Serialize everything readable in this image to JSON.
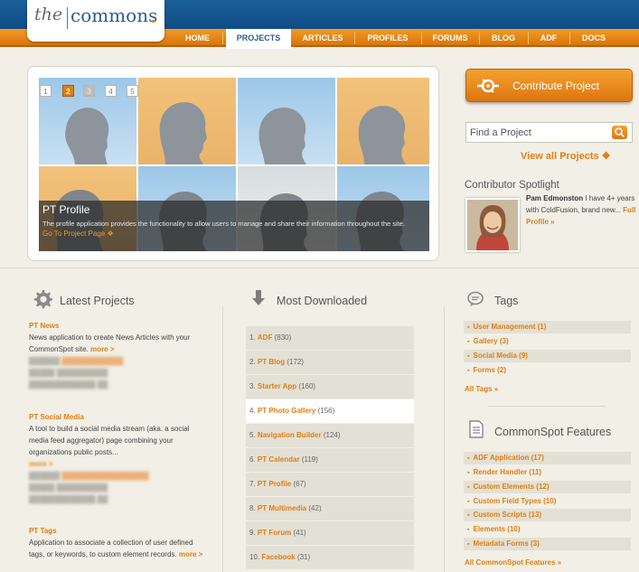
{
  "logo": {
    "the": "the",
    "commons": "commons",
    "dot": "."
  },
  "nav": {
    "items": [
      {
        "label": "HOME"
      },
      {
        "label": "PROJECTS"
      },
      {
        "label": "ARTICLES"
      },
      {
        "label": "PROFILES"
      },
      {
        "label": "FORUMS"
      },
      {
        "label": "BLOG"
      },
      {
        "label": "ADF"
      },
      {
        "label": "DOCS"
      }
    ],
    "active": "PROJECTS"
  },
  "slideshow": {
    "pages": [
      "1",
      "2",
      "3",
      "4",
      "5"
    ],
    "current_page": "2",
    "caption_title": "PT Profile",
    "caption_text": "The profile application provides the functionality to allow users to manage and share their information throughout the site.",
    "caption_link": "Go To Project Page ❖"
  },
  "contribute": {
    "label": "Contribute Project",
    "icon": "contribute-icon"
  },
  "find_project": {
    "placeholder": "Find a Project",
    "icon": "search-icon"
  },
  "view_all": "View all Projects ❖",
  "spotlight": {
    "title": "Contributor Spotlight",
    "name": "Pam Edmonston",
    "text": " I have 4+ years with ColdFusion, brand new... ",
    "link": "Full Profile »"
  },
  "latest": {
    "title": "Latest Projects",
    "icon": "gear-icon",
    "items": [
      {
        "name": "PT News",
        "desc": "News application to create News Articles with your CommonSpot site.",
        "more": "more >"
      },
      {
        "name": "PT Social Media",
        "desc": "A tool to build a social media stream (aka. a social media feed aggregator) page combining your organizations public posts...",
        "more": "more >"
      },
      {
        "name": "PT Tags",
        "desc": "Application to associate a collection of user defined tags, or keywords, to custom element records.",
        "more": "more >"
      }
    ]
  },
  "downloaded": {
    "title": "Most Downloaded",
    "icon": "download-arrow-icon",
    "items": [
      {
        "rank": "1.",
        "name": "ADF",
        "count": "(830)"
      },
      {
        "rank": "2.",
        "name": "PT Blog",
        "count": "(172)"
      },
      {
        "rank": "3.",
        "name": "Starter App",
        "count": "(160)"
      },
      {
        "rank": "4.",
        "name": "PT Photo Gallery",
        "count": "(156)"
      },
      {
        "rank": "5.",
        "name": "Navigation Builder",
        "count": "(124)"
      },
      {
        "rank": "6.",
        "name": "PT Calendar",
        "count": "(119)"
      },
      {
        "rank": "7.",
        "name": "PT Profile",
        "count": "(67)"
      },
      {
        "rank": "8.",
        "name": "PT Multimedia",
        "count": "(42)"
      },
      {
        "rank": "9.",
        "name": "PT Forum",
        "count": "(41)"
      },
      {
        "rank": "10.",
        "name": "Facebook",
        "count": "(31)"
      }
    ]
  },
  "tags": {
    "title": "Tags",
    "icon": "speech-bubble-icon",
    "items": [
      "User Management (1)",
      "Gallery (3)",
      "Social Media (9)",
      "Forms (2)"
    ],
    "all_link": "All Tags »"
  },
  "features": {
    "title": "CommonSpot Features",
    "icon": "document-icon",
    "items": [
      "ADF Application (17)",
      "Render Handler (11)",
      "Custom Elements (12)",
      "Custom Field Types (10)",
      "Custom Scripts (13)",
      "Elements (10)",
      "Metadata Forms (3)"
    ],
    "all_link": "All CommonSpot Features »"
  }
}
